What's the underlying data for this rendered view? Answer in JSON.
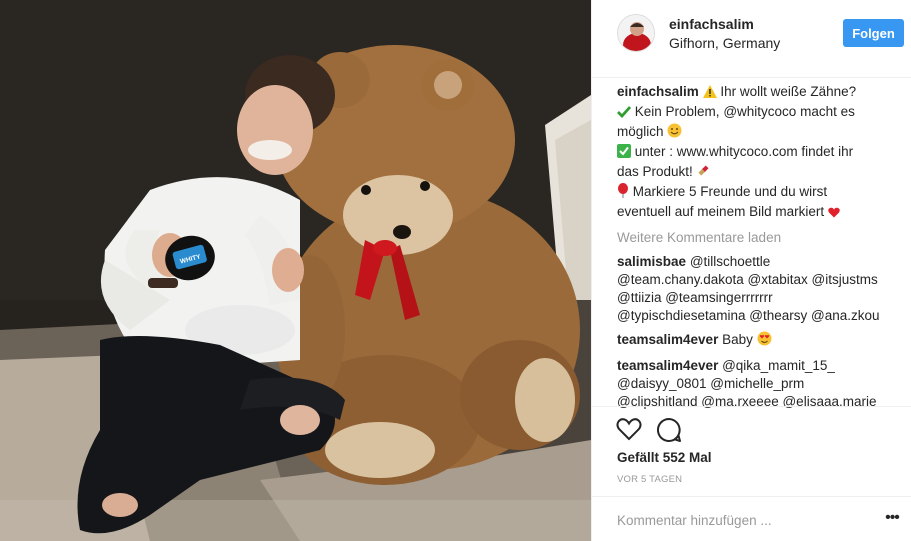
{
  "post": {
    "photo_alt": "Photo of a person with a giant teddy bear holding a product",
    "product_label": "WHITY"
  },
  "header": {
    "username": "einfachsalim",
    "location": "Gifhorn, Germany",
    "follow_label": "Folgen"
  },
  "caption": {
    "username": "einfachsalim",
    "line1": "Ihr wollt weiße Zähne?",
    "line2_pre": "Kein Problem,",
    "line2_mention": "@whitycoco",
    "line2_post": "macht es",
    "line3": "möglich",
    "line4": "unter : www.whitycoco.com findet ihr",
    "line5": "das Produkt!",
    "line6": "Markiere 5 Freunde und du wirst",
    "line7": "eventuell auf meinem Bild markiert"
  },
  "load_more_label": "Weitere Kommentare laden",
  "comments": [
    {
      "username": "salimisbae",
      "lines": [
        "@tillschoettle",
        "@team.chany.dakota @xtabitax @itsjustms",
        "@ttiizia @teamsingerrrrrrr",
        "@typischdiesetamina @thearsy @ana.zkou"
      ]
    },
    {
      "username": "teamsalim4ever",
      "lines": [
        "Baby"
      ]
    },
    {
      "username": "teamsalim4ever",
      "lines": [
        "@qika_mamit_15_",
        "@daisyy_0801 @michelle_prm",
        "@clipshitland @ma.rxeeee @elisaaa.marie"
      ]
    }
  ],
  "actions": {
    "like_icon": "heart-icon",
    "comment_icon": "speech-bubble-icon",
    "likes_text": "Gefällt 552 Mal",
    "timestamp": "VOR 5 TAGEN"
  },
  "add_comment": {
    "placeholder": "Kommentar hinzufügen ...",
    "more_label": "•••"
  },
  "colors": {
    "follow_button": "#3897f0",
    "muted_text": "#999999",
    "border": "#efefef"
  }
}
